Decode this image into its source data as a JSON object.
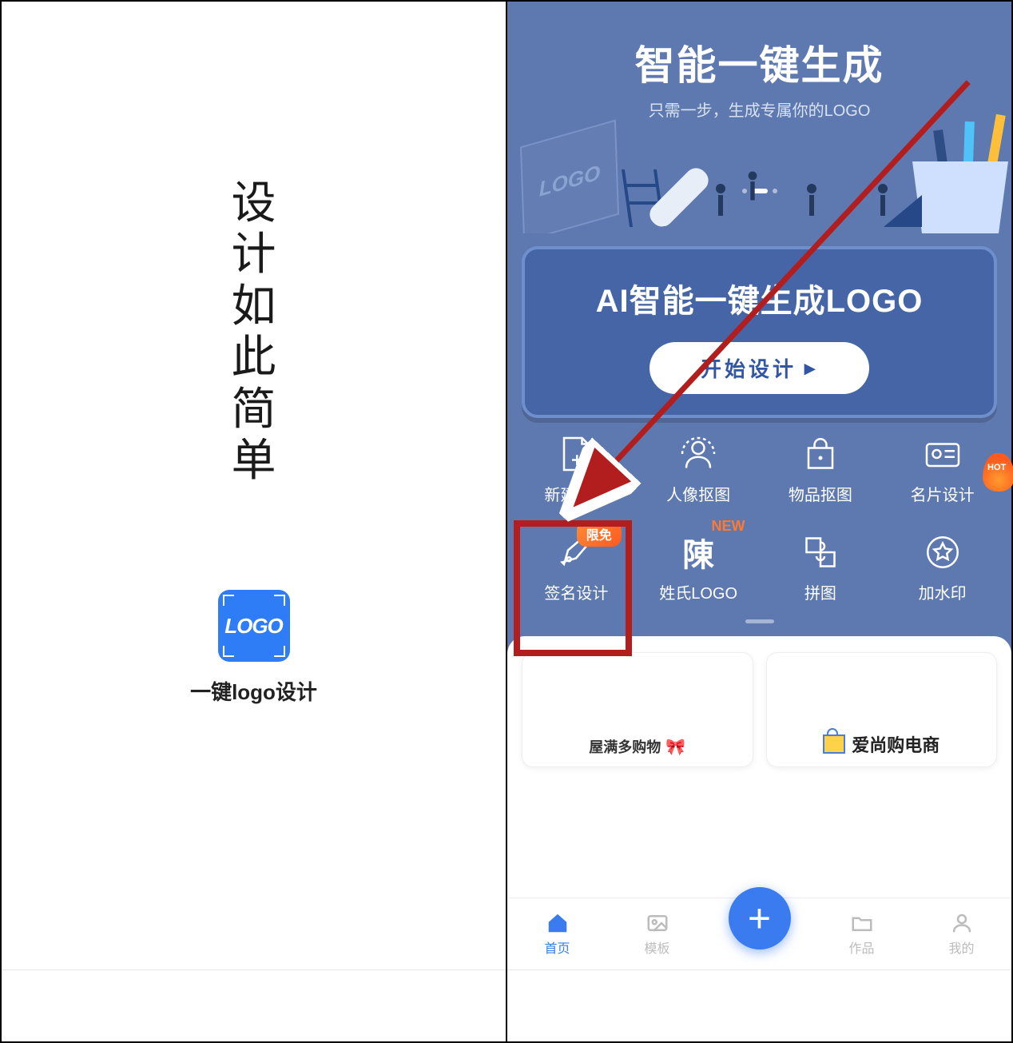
{
  "left": {
    "slogan": "设计如此简单",
    "app_icon_text": "LOGO",
    "app_name": "一键logo设计"
  },
  "right": {
    "hero": {
      "title": "智能一键生成",
      "subtitle": "只需一步，生成专属你的LOGO",
      "board_text": "LOGO"
    },
    "ai_card": {
      "title": "AI智能一键生成LOGO",
      "button": "开始设计"
    },
    "flame_badge": "HOT",
    "features": [
      {
        "label": "新建画布"
      },
      {
        "label": "人像抠图"
      },
      {
        "label": "物品抠图"
      },
      {
        "label": "名片设计"
      },
      {
        "label": "签名设计",
        "badge": "限免"
      },
      {
        "label": "姓氏LOGO",
        "new": "NEW",
        "glyph": "陳"
      },
      {
        "label": "拼图"
      },
      {
        "label": "加水印"
      }
    ],
    "templates": [
      {
        "brand": "屋满多购物"
      },
      {
        "brand": "爱尚购电商"
      }
    ],
    "nav": [
      {
        "label": "首页",
        "active": true
      },
      {
        "label": "模板",
        "active": false
      },
      {
        "label": "作品",
        "active": false
      },
      {
        "label": "我的",
        "active": false
      }
    ]
  }
}
